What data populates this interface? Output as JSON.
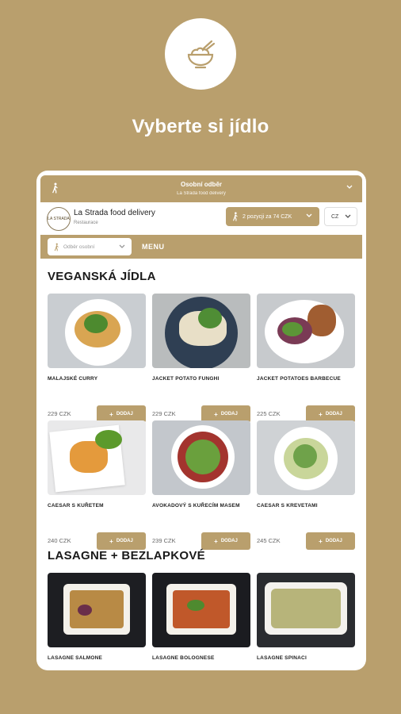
{
  "hero": {
    "title": "Vyberte si jídlo",
    "icon": "rice-bowl-icon"
  },
  "pickup": {
    "title": "Osobní odběr",
    "subtitle": "La Strada food delivery"
  },
  "restaurant": {
    "logo_text": "LA STRADA",
    "name": "La Strada food delivery",
    "subtitle": "Restaurace"
  },
  "cart": {
    "label": "2 pozycji za 74 CZK"
  },
  "language": {
    "selected": "CZ"
  },
  "menubar": {
    "pickup_dropdown": "Odběr osobní",
    "menu_label": "MENU"
  },
  "sections": [
    {
      "title": "VEGANSKÁ JÍDLA",
      "items": [
        {
          "name": "MALAJSKÉ CURRY",
          "price": "229 CZK",
          "add_label": "DODAJ"
        },
        {
          "name": "JACKET POTATO FUNGHI",
          "price": "229 CZK",
          "add_label": "DODAJ"
        },
        {
          "name": "JACKET POTATOES BARBECUE",
          "price": "225 CZK",
          "add_label": "DODAJ"
        },
        {
          "name": "CAESAR S KUŘETEM",
          "price": "240 CZK",
          "add_label": "DODAJ"
        },
        {
          "name": "AVOKADOVÝ S KUŘECÍM MASEM",
          "price": "239 CZK",
          "add_label": "DODAJ"
        },
        {
          "name": "CAESAR S KREVETAMI",
          "price": "245 CZK",
          "add_label": "DODAJ"
        }
      ]
    },
    {
      "title": "LASAGNE + BEZLAPKOVÉ",
      "items": [
        {
          "name": "LASAGNE SALMONE"
        },
        {
          "name": "LASAGNE BOLOGNESE"
        },
        {
          "name": "LASAGNE SPINACI"
        }
      ]
    }
  ],
  "colors": {
    "brand": "#b99f6d",
    "white": "#ffffff",
    "text": "#1a1a1a"
  }
}
